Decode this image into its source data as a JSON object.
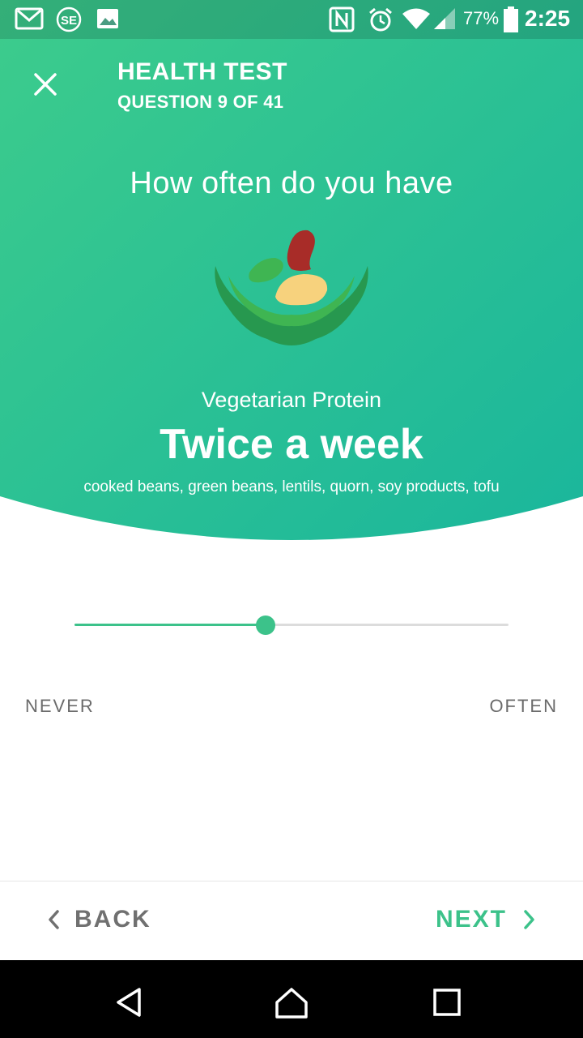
{
  "status_bar": {
    "battery_percent": "77%",
    "time": "2:25",
    "icons": [
      "gmail-icon",
      "se-app-icon",
      "gallery-icon",
      "nfc-icon",
      "alarm-icon",
      "wifi-icon",
      "signal-icon",
      "battery-icon"
    ]
  },
  "header": {
    "title": "HEALTH TEST",
    "progress": "QUESTION 9 OF 41"
  },
  "question": {
    "prompt": "How often do you have",
    "category": "Vegetarian Protein",
    "answer": "Twice a week",
    "examples": "cooked beans, green beans, lentils, quorn, soy products, tofu"
  },
  "slider": {
    "value_fraction": 0.44,
    "min_label": "NEVER",
    "max_label": "OFTEN"
  },
  "actions": {
    "back_label": "BACK",
    "next_label": "NEXT"
  },
  "colors": {
    "accent": "#3cc28a",
    "hero_top": "#3dcc8c",
    "hero_bottom": "#1db99b"
  }
}
